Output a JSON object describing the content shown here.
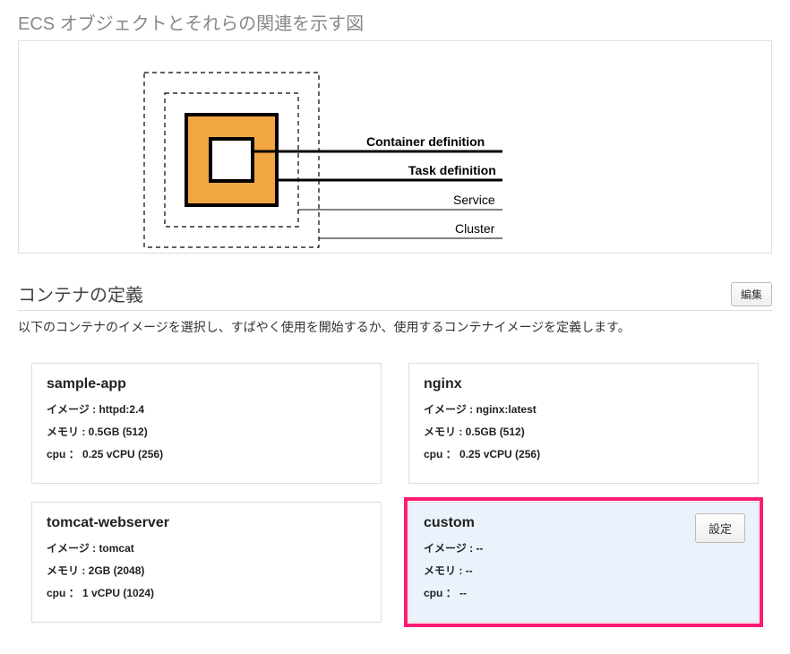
{
  "diagram": {
    "title": "ECS オブジェクトとそれらの関連を示す図",
    "labels": {
      "container_definition": "Container definition",
      "task_definition": "Task definition",
      "service": "Service",
      "cluster": "Cluster"
    }
  },
  "container_section": {
    "title": "コンテナの定義",
    "edit_label": "編集",
    "description": "以下のコンテナのイメージを選択し、すばやく使用を開始するか、使用するコンテナイメージを定義します。",
    "field_labels": {
      "image": "イメージ :",
      "memory": "メモリ :",
      "cpu": "cpu ："
    },
    "settings_label": "設定",
    "cards": [
      {
        "name": "sample-app",
        "image": "httpd:2.4",
        "memory": "0.5GB (512)",
        "cpu": "0.25 vCPU (256)",
        "highlighted": false,
        "has_settings": false
      },
      {
        "name": "nginx",
        "image": "nginx:latest",
        "memory": "0.5GB (512)",
        "cpu": "0.25 vCPU (256)",
        "highlighted": false,
        "has_settings": false
      },
      {
        "name": "tomcat-webserver",
        "image": "tomcat",
        "memory": "2GB (2048)",
        "cpu": "1 vCPU (1024)",
        "highlighted": false,
        "has_settings": false
      },
      {
        "name": "custom",
        "image": "--",
        "memory": "--",
        "cpu": "--",
        "highlighted": true,
        "has_settings": true
      }
    ]
  }
}
